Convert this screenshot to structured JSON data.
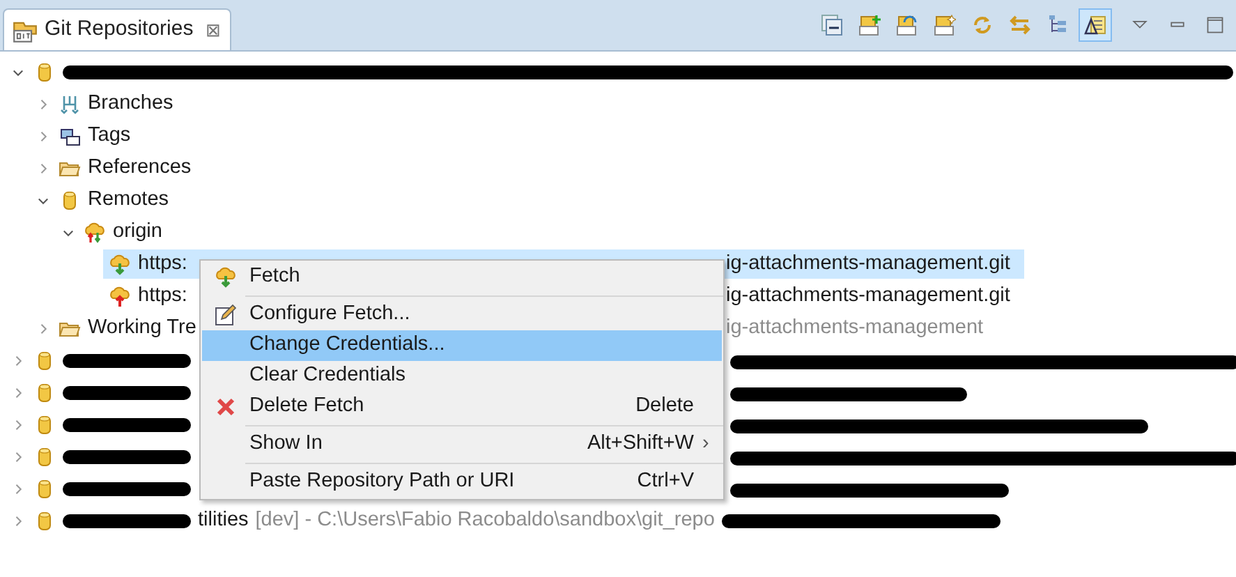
{
  "view": {
    "title": "Git Repositories",
    "close": "⊠",
    "toolbar": [
      {
        "kind": "collapse",
        "selected": false
      },
      {
        "kind": "add",
        "selected": false
      },
      {
        "kind": "clone",
        "selected": false
      },
      {
        "kind": "create",
        "selected": false
      },
      {
        "kind": "refresh",
        "selected": false
      },
      {
        "kind": "sync",
        "selected": false
      },
      {
        "kind": "hierarchy",
        "selected": false
      },
      {
        "kind": "link",
        "selected": true
      }
    ]
  },
  "tree": [
    {
      "kind": "repo",
      "expanded": true,
      "children": [
        {
          "kind": "branches",
          "label": "Branches",
          "expanded": false
        },
        {
          "kind": "tags",
          "label": "Tags",
          "expanded": false
        },
        {
          "kind": "folder",
          "label": "References",
          "expanded": false
        },
        {
          "kind": "remotes",
          "label": "Remotes",
          "expanded": true,
          "children": [
            {
              "kind": "origin",
              "label": "origin",
              "expanded": true,
              "children": [
                {
                  "kind": "fetch",
                  "label": "https:",
                  "tail": "ig-attachments-management.git",
                  "selected": true
                },
                {
                  "kind": "push",
                  "label": "https:",
                  "tail": "ig-attachments-management.git",
                  "selected": false
                }
              ]
            }
          ]
        },
        {
          "kind": "folder",
          "label": "Working Tre",
          "tail": "ig-attachments-management",
          "tail_dim": true,
          "expanded": false
        }
      ]
    },
    {
      "kind": "repo",
      "expanded": false
    },
    {
      "kind": "repo",
      "expanded": false
    },
    {
      "kind": "repo",
      "expanded": false
    },
    {
      "kind": "repo",
      "expanded": false
    },
    {
      "kind": "repo",
      "expanded": false
    },
    {
      "kind": "repo",
      "expanded": false,
      "name_fragment": "tilities",
      "path_fragment": "[dev] - C:\\Users\\Fabio Racobaldo\\sandbox\\git_repo"
    }
  ],
  "context_menu": [
    {
      "kind": "item",
      "label": "Fetch",
      "selected": false
    },
    {
      "kind": "separator"
    },
    {
      "kind": "item",
      "label": "Configure Fetch...",
      "selected": false
    },
    {
      "kind": "item",
      "label": "Change Credentials...",
      "selected": true
    },
    {
      "kind": "item",
      "label": "Clear Credentials",
      "selected": false
    },
    {
      "kind": "item",
      "label": "Delete Fetch",
      "shortcut": "Delete",
      "selected": false
    },
    {
      "kind": "separator"
    },
    {
      "kind": "item",
      "label": "Show In",
      "shortcut": "Alt+Shift+W",
      "submenu": "›",
      "selected": false
    },
    {
      "kind": "separator"
    },
    {
      "kind": "item",
      "label": "Paste Repository Path or URI",
      "shortcut": "Ctrl+V",
      "selected": false
    }
  ]
}
